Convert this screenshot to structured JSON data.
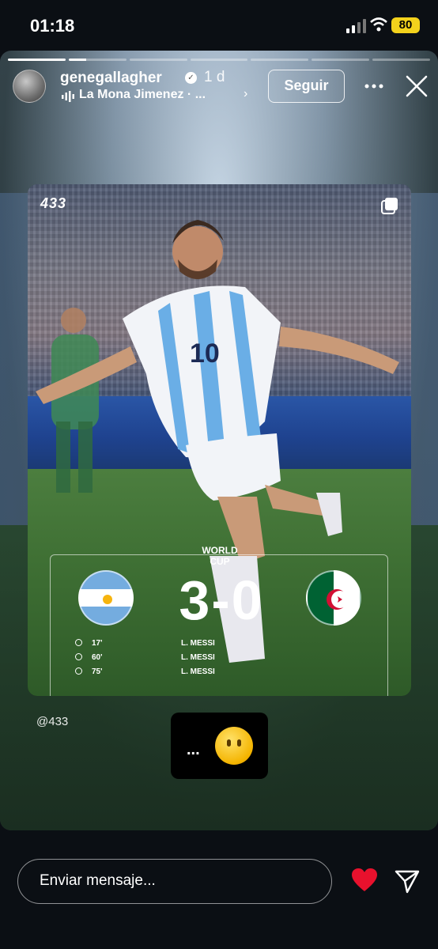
{
  "status_bar": {
    "time": "01:18",
    "battery": "80"
  },
  "story": {
    "progress_total": 7,
    "progress_done": 1,
    "user": {
      "username": "genegallagher",
      "age": "1 d",
      "verified_icon": "verified-badge-icon"
    },
    "music": {
      "title": "La Mona Jimenez · ..."
    },
    "follow_label": "Seguir",
    "post": {
      "brand": "433",
      "competition": "WORLD CUP",
      "home_flag": "argentina-flag",
      "away_flag": "algeria-flag",
      "score": "3-0",
      "goals": [
        {
          "minute": "17'",
          "scorer": "L. MESSI"
        },
        {
          "minute": "60'",
          "scorer": "L. MESSI"
        },
        {
          "minute": "75'",
          "scorer": "L. MESSI"
        }
      ]
    },
    "handle": "@433",
    "reaction": {
      "text": "...",
      "emoji": "face-without-mouth-emoji"
    }
  },
  "bottom_bar": {
    "message_placeholder": "Enviar mensaje...",
    "liked": true,
    "colors": {
      "heart": "#e8112d"
    }
  }
}
